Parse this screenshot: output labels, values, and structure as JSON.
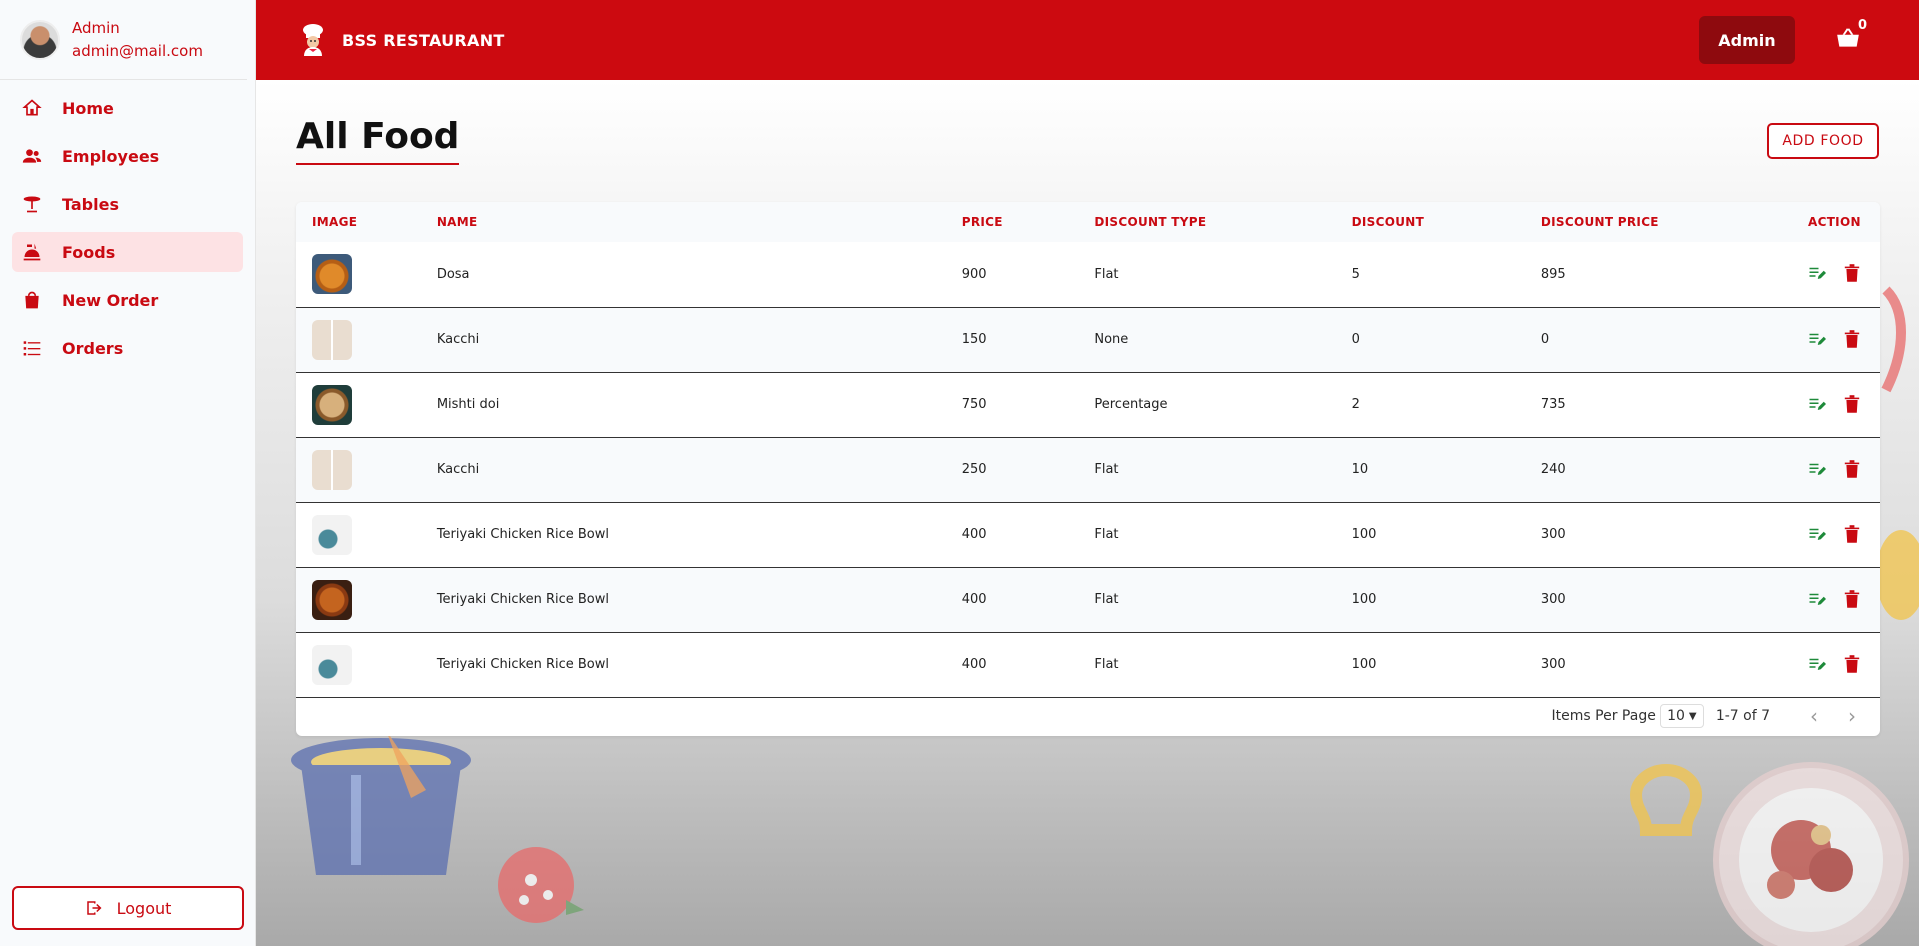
{
  "sidebar": {
    "user": {
      "name": "Admin",
      "email": "admin@mail.com"
    },
    "items": [
      {
        "label": "Home",
        "icon": "home-icon"
      },
      {
        "label": "Employees",
        "icon": "users-icon"
      },
      {
        "label": "Tables",
        "icon": "table-icon"
      },
      {
        "label": "Foods",
        "icon": "food-icon",
        "active": true
      },
      {
        "label": "New Order",
        "icon": "bag-icon"
      },
      {
        "label": "Orders",
        "icon": "list-icon"
      }
    ],
    "logout_label": "Logout"
  },
  "topbar": {
    "brand": "BSS RESTAURANT",
    "admin_label": "Admin",
    "cart_count": "0",
    "colors": {
      "primary": "#cc0a10",
      "admin_button": "#8e0a0e"
    }
  },
  "page": {
    "title": "All Food",
    "add_button": "ADD FOOD"
  },
  "table": {
    "headers": [
      "IMAGE",
      "NAME",
      "PRICE",
      "DISCOUNT TYPE",
      "DISCOUNT",
      "DISCOUNT PRICE",
      "ACTION"
    ],
    "rows": [
      {
        "image": "dosa-image",
        "name": "Dosa",
        "price": "900",
        "discount_type": "Flat",
        "discount": "5",
        "discount_price": "895"
      },
      {
        "image": "kacchi-image",
        "name": "Kacchi",
        "price": "150",
        "discount_type": "None",
        "discount": "0",
        "discount_price": "0"
      },
      {
        "image": "mishti-doi-image",
        "name": "Mishti doi",
        "price": "750",
        "discount_type": "Percentage",
        "discount": "2",
        "discount_price": "735"
      },
      {
        "image": "kacchi-image",
        "name": "Kacchi",
        "price": "250",
        "discount_type": "Flat",
        "discount": "10",
        "discount_price": "240"
      },
      {
        "image": "teriyaki-bowl-image",
        "name": "Teriyaki Chicken Rice Bowl",
        "price": "400",
        "discount_type": "Flat",
        "discount": "100",
        "discount_price": "300"
      },
      {
        "image": "fried-chicken-image",
        "name": "Teriyaki Chicken Rice Bowl",
        "price": "400",
        "discount_type": "Flat",
        "discount": "100",
        "discount_price": "300"
      },
      {
        "image": "teriyaki-bowl-image",
        "name": "Teriyaki Chicken Rice Bowl",
        "price": "400",
        "discount_type": "Flat",
        "discount": "100",
        "discount_price": "300"
      }
    ]
  },
  "pagination": {
    "items_per_page_label": "Items Per Page",
    "per_page_value": "10",
    "range_label": "1-7 of 7"
  }
}
